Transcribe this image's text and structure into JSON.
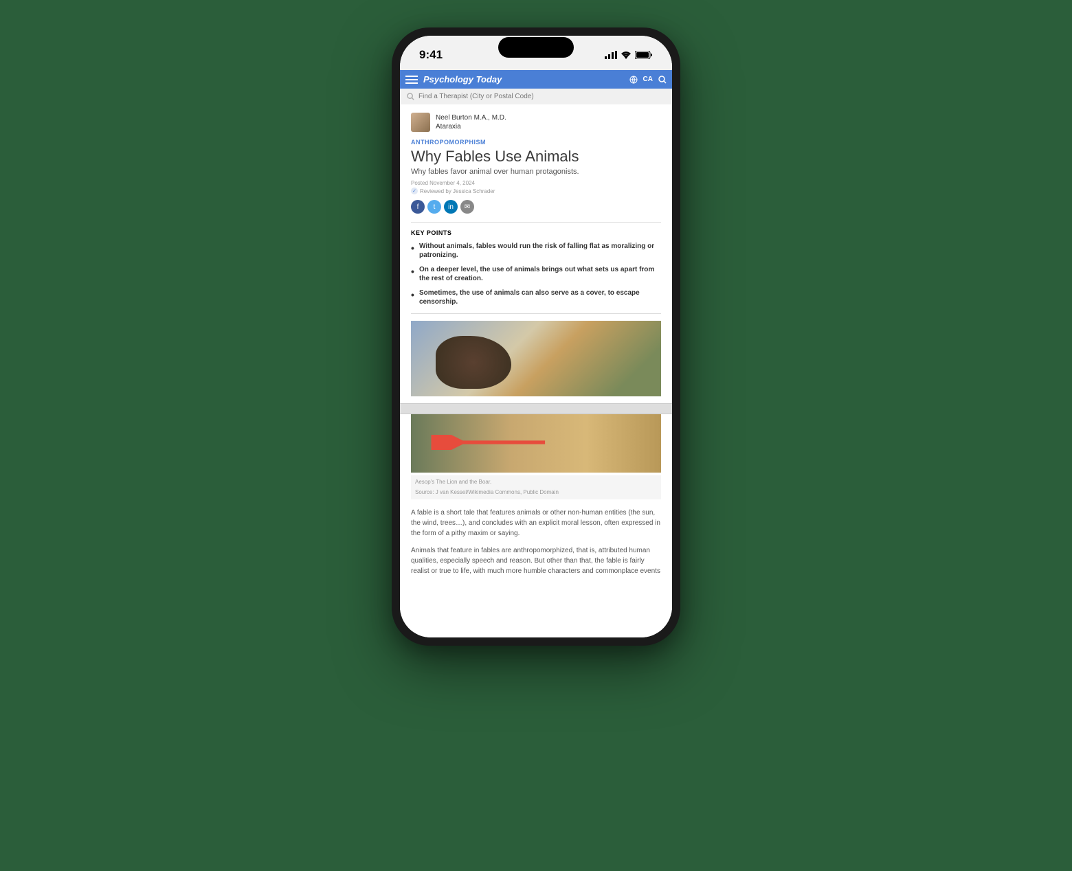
{
  "status": {
    "time": "9:41"
  },
  "nav": {
    "brand": "Psychology Today",
    "locale": "CA"
  },
  "search": {
    "placeholder": "Find a Therapist (City or Postal Code)"
  },
  "author": {
    "name": "Neel Burton M.A., M.D.",
    "series": "Ataraxia"
  },
  "article": {
    "category": "ANTHROPOMORPHISM",
    "title": "Why Fables Use Animals",
    "subtitle": "Why fables favor animal over human protagonists.",
    "posted": "Posted November 4, 2024",
    "reviewed": "Reviewed by Jessica Schrader"
  },
  "keypoints": {
    "header": "KEY POINTS",
    "items": [
      "Without animals, fables would run the risk of falling flat as moralizing or patronizing.",
      "On a deeper level, the use of animals brings out what sets us apart from the rest of creation.",
      "Sometimes, the use of animals can also serve as a cover, to escape censorship."
    ]
  },
  "image": {
    "caption_title": "Aesop's The Lion and the Boar.",
    "caption_source": "Source: J van Kessel/Wikimedia Commons, Public Domain"
  },
  "body": {
    "p1": "A fable is a short tale that features animals or other non-human entities (the sun, the wind, trees…), and concludes with an explicit moral lesson, often expressed in the form of a pithy maxim or saying.",
    "p2": "Animals that feature in fables are anthropomorphized, that is, attributed human qualities, especially speech and reason. But other than that, the fable is fairly realist or true to life, with much more humble characters and commonplace events"
  },
  "share": {
    "fb": "f",
    "tw": "t",
    "li": "in",
    "em": "✉"
  },
  "colors": {
    "accent": "#4a7fd6",
    "arrow": "#e74c3c"
  }
}
